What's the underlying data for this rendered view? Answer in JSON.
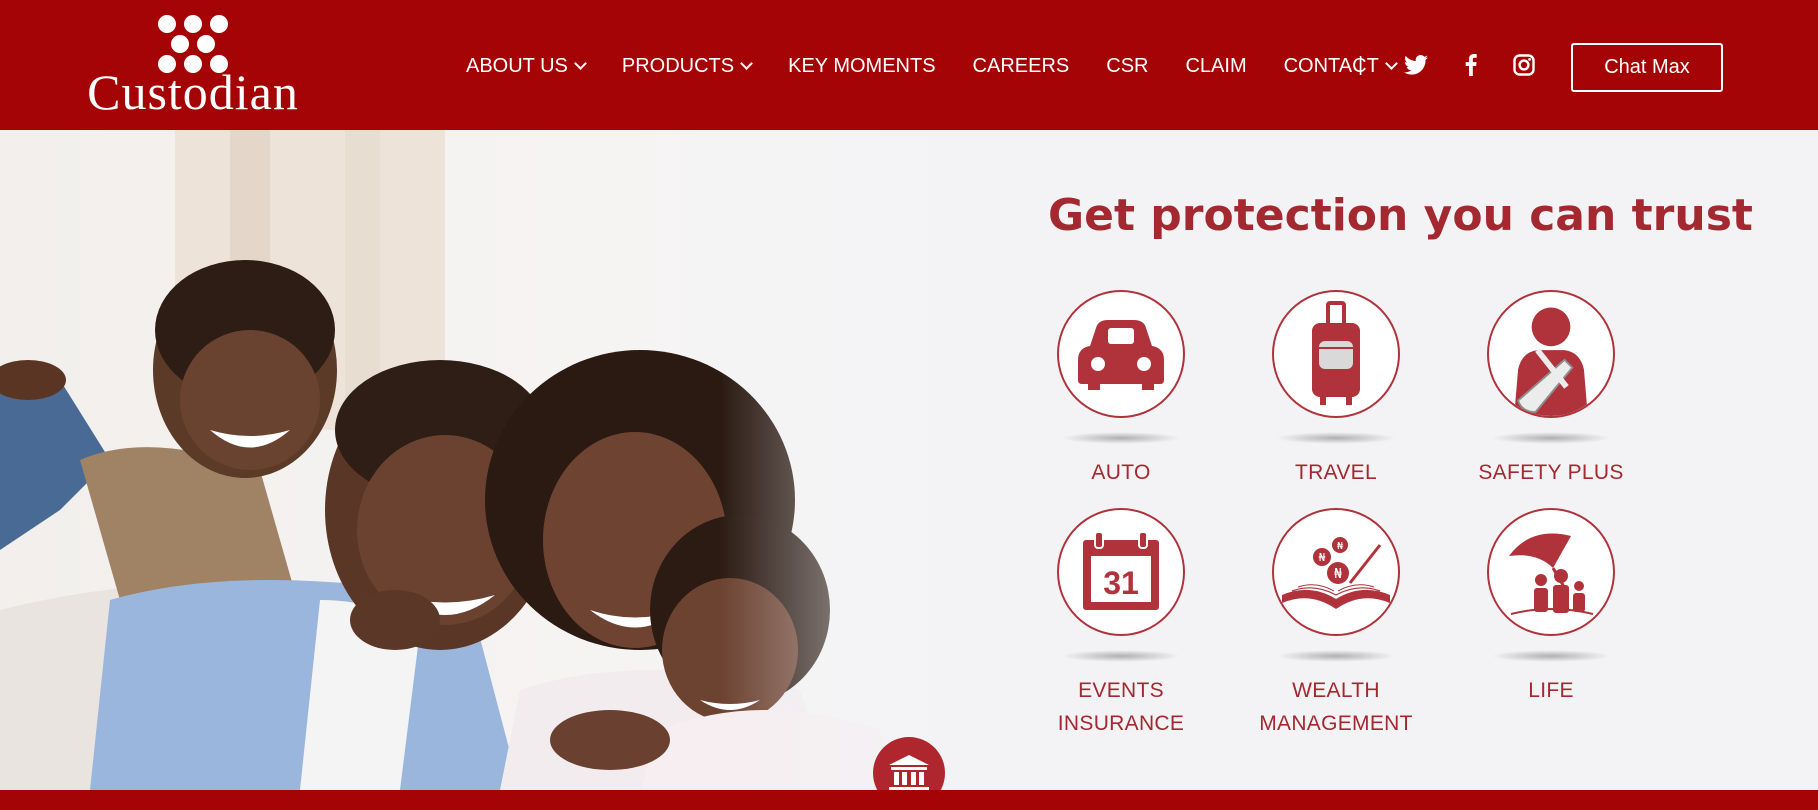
{
  "brand": {
    "name": "Custodian",
    "primary_color": "#a50406",
    "accent_text_color": "#a3282f"
  },
  "nav": {
    "items": [
      {
        "label": "ABOUT US",
        "dropdown": true
      },
      {
        "label": "PRODUCTS",
        "dropdown": true
      },
      {
        "label": "KEY MOMENTS",
        "dropdown": false
      },
      {
        "label": "CAREERS",
        "dropdown": false
      },
      {
        "label": "CSR",
        "dropdown": false
      },
      {
        "label": "CLAIM",
        "dropdown": false
      },
      {
        "label": "CONTACT",
        "dropdown": true
      }
    ],
    "separator": "|",
    "social_icons": [
      "twitter-icon",
      "facebook-icon",
      "instagram-icon"
    ],
    "chat_button": "Chat Max"
  },
  "hero": {
    "headline": "Get protection you can trust",
    "products": [
      {
        "icon": "car-icon",
        "lines": [
          "AUTO"
        ]
      },
      {
        "icon": "luggage-icon",
        "lines": [
          "TRAVEL"
        ]
      },
      {
        "icon": "injured-person-icon",
        "lines": [
          "SAFETY PLUS"
        ]
      },
      {
        "icon": "calendar-icon",
        "lines": [
          "EVENTS",
          "INSURANCE"
        ],
        "calendar_day": "31"
      },
      {
        "icon": "wealth-book-icon",
        "lines": [
          "WEALTH",
          "MANAGEMENT"
        ],
        "coin_symbol": "₦"
      },
      {
        "icon": "family-umbrella-icon",
        "lines": [
          "LIFE"
        ]
      }
    ],
    "floating_icon": "bank-icon"
  }
}
